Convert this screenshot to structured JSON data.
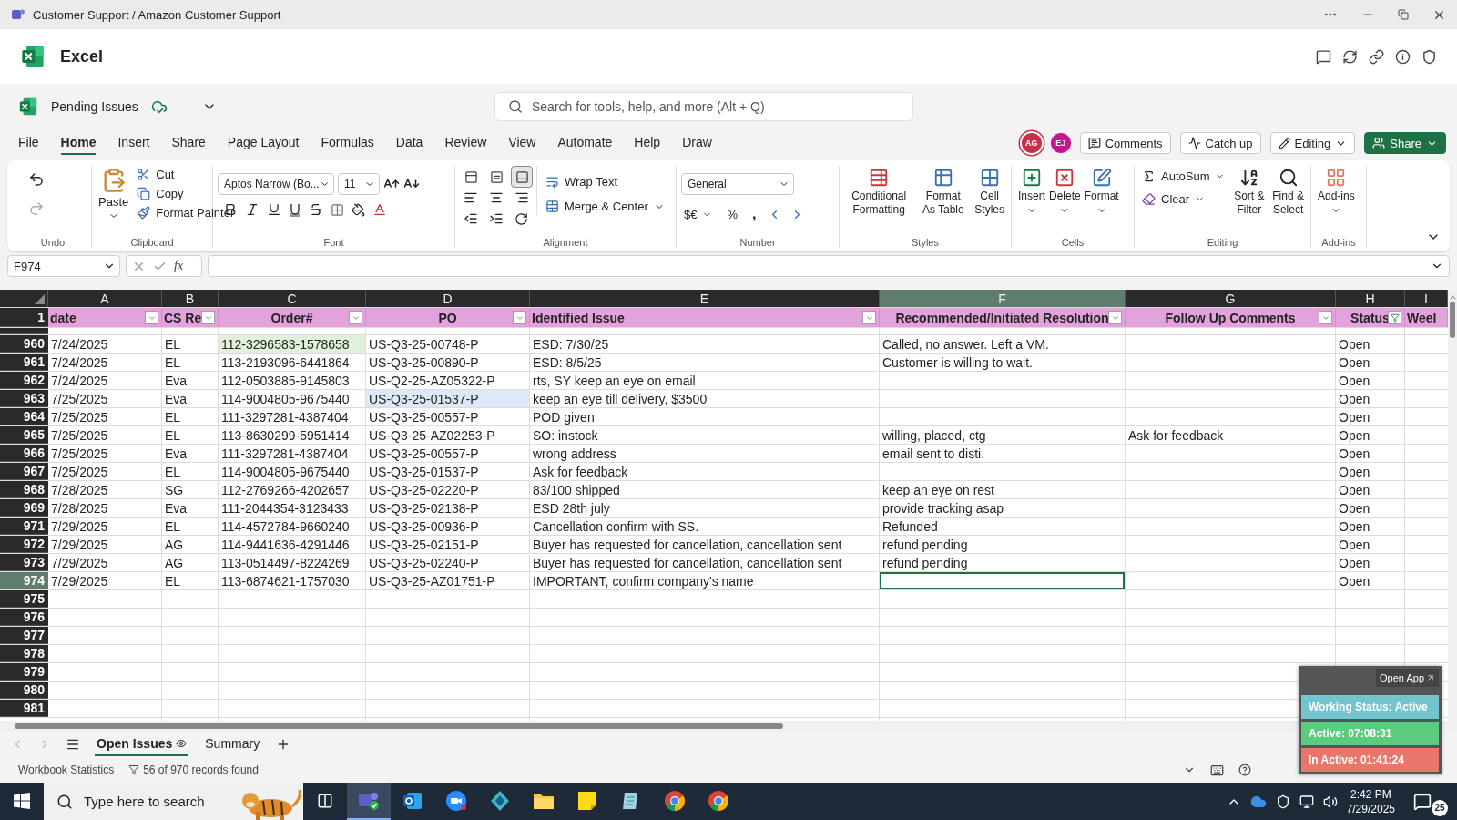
{
  "window": {
    "title": "Customer Support / Amazon Customer Support"
  },
  "app": {
    "name": "Excel"
  },
  "file": {
    "name": "Pending Issues"
  },
  "search": {
    "placeholder": "Search for tools, help, and more (Alt + Q)"
  },
  "menu": [
    {
      "label": "File",
      "selected": false
    },
    {
      "label": "Home",
      "selected": true
    },
    {
      "label": "Insert",
      "selected": false
    },
    {
      "label": "Share",
      "selected": false
    },
    {
      "label": "Page Layout",
      "selected": false
    },
    {
      "label": "Formulas",
      "selected": false
    },
    {
      "label": "Data",
      "selected": false
    },
    {
      "label": "Review",
      "selected": false
    },
    {
      "label": "View",
      "selected": false
    },
    {
      "label": "Automate",
      "selected": false
    },
    {
      "label": "Help",
      "selected": false
    },
    {
      "label": "Draw",
      "selected": false
    }
  ],
  "collaborators": [
    {
      "initials": "AG",
      "color": "#c4314b"
    },
    {
      "initials": "EJ",
      "color": "#c2188f"
    }
  ],
  "actions": {
    "comments": "Comments",
    "catch_up": "Catch up",
    "mode": "Editing",
    "share": "Share"
  },
  "ribbon": {
    "undo": {
      "label": "Undo"
    },
    "clipboard": {
      "label": "Clipboard",
      "paste": "Paste",
      "items": [
        "Cut",
        "Copy",
        "Format Painter"
      ]
    },
    "font": {
      "label": "Font",
      "family": "Aptos Narrow (Bo...",
      "size": "11"
    },
    "alignment": {
      "label": "Alignment",
      "vertical": [
        {
          "selected": false
        },
        {
          "selected": false
        },
        {
          "selected": true
        }
      ],
      "wrap": "Wrap Text",
      "merge": "Merge & Center"
    },
    "number": {
      "label": "Number",
      "format": "General",
      "currency": "$€",
      "percent": "%",
      "comma": ","
    },
    "styles": {
      "label": "Styles",
      "items": [
        "Conditional Formatting",
        "Format As Table",
        "Cell Styles"
      ]
    },
    "cells": {
      "label": "Cells",
      "items": [
        "Insert",
        "Delete",
        "Format"
      ]
    },
    "editing": {
      "label": "Editing",
      "autosum": "AutoSum",
      "clear": "Clear",
      "items": [
        "Sort & Filter",
        "Find & Select"
      ]
    },
    "addins": {
      "label": "Add-ins",
      "button": "Add-ins"
    }
  },
  "formula_bar": {
    "name_box": "F974",
    "function_label": "fx"
  },
  "columns": [
    {
      "letter": "A",
      "selected": false
    },
    {
      "letter": "B",
      "selected": false
    },
    {
      "letter": "C",
      "selected": false
    },
    {
      "letter": "D",
      "selected": false
    },
    {
      "letter": "E",
      "selected": false
    },
    {
      "letter": "F",
      "selected": true
    },
    {
      "letter": "G",
      "selected": false
    },
    {
      "letter": "H",
      "selected": false
    },
    {
      "letter": "I",
      "selected": false
    }
  ],
  "header_row": {
    "num": "1",
    "cells": [
      {
        "text": "date",
        "filtered": false
      },
      {
        "text": "CS Re",
        "filtered": false
      },
      {
        "text": "Order#",
        "filtered": false
      },
      {
        "text": "PO",
        "filtered": false
      },
      {
        "text": "Identified Issue",
        "filtered": false
      },
      {
        "text": "Recommended/Initiated Resolution",
        "filtered": false
      },
      {
        "text": "Follow Up Comments",
        "filtered": false
      },
      {
        "text": "Status",
        "filtered": true
      },
      {
        "text": "Weel"
      }
    ]
  },
  "rows": [
    {
      "num": "960",
      "selected": false,
      "date": "7/24/2025",
      "rep": "EL",
      "order": "112-3296583-1578658",
      "po": "US-Q3-25-00748-P",
      "issue": "ESD: 7/30/25",
      "resolution": "Called, no answer. Left a VM.",
      "status": "Open",
      "highlight": {
        "order": {
          "color": "#e2efda"
        }
      }
    },
    {
      "num": "961",
      "selected": false,
      "date": "7/24/2025",
      "rep": "EL",
      "order": "113-2193096-6441864",
      "po": "US-Q3-25-00890-P",
      "issue": "ESD: 8/5/25",
      "resolution": "Customer is willing to wait.",
      "status": "Open"
    },
    {
      "num": "962",
      "selected": false,
      "date": "7/24/2025",
      "rep": "Eva",
      "order": "112-0503885-9145803",
      "po": "US-Q2-25-AZ05322-P",
      "issue": "rts, SY keep an eye on email",
      "status": "Open"
    },
    {
      "num": "963",
      "selected": false,
      "date": "7/25/2025",
      "rep": "Eva",
      "order": "114-9004805-9675440",
      "po": "US-Q3-25-01537-P",
      "issue": "keep an eye till delivery, $3500",
      "status": "Open",
      "highlight": {
        "po": {
          "color": "#dde9f6"
        }
      }
    },
    {
      "num": "964",
      "selected": false,
      "date": "7/25/2025",
      "rep": "EL",
      "order": "111-3297281-4387404",
      "po": "US-Q3-25-00557-P",
      "issue": "POD given",
      "status": "Open"
    },
    {
      "num": "965",
      "selected": false,
      "date": "7/25/2025",
      "rep": "EL",
      "order": "113-8630299-5951414",
      "po": "US-Q3-25-AZ02253-P",
      "issue": "SO: instock",
      "resolution": "willing, placed, ctg",
      "followup": "Ask for feedback",
      "status": "Open"
    },
    {
      "num": "966",
      "selected": false,
      "date": "7/25/2025",
      "rep": "Eva",
      "order": "111-3297281-4387404",
      "po": "US-Q3-25-00557-P",
      "issue": "wrong address",
      "resolution": "email sent to disti.",
      "status": "Open"
    },
    {
      "num": "967",
      "selected": false,
      "date": "7/25/2025",
      "rep": "EL",
      "order": "114-9004805-9675440",
      "po": "US-Q3-25-01537-P",
      "issue": "Ask for feedback",
      "status": "Open"
    },
    {
      "num": "968",
      "selected": false,
      "date": "7/28/2025",
      "rep": "SG",
      "order": "112-2769266-4202657",
      "po": "US-Q3-25-02220-P",
      "issue": "83/100 shipped",
      "resolution": "keep an eye on rest",
      "status": "Open"
    },
    {
      "num": "969",
      "selected": false,
      "date": "7/28/2025",
      "rep": "Eva",
      "order": "111-2044354-3123433",
      "po": "US-Q3-25-02138-P",
      "issue": "ESD 28th july",
      "resolution": "provide tracking asap",
      "status": "Open"
    },
    {
      "num": "971",
      "selected": false,
      "date": "7/29/2025",
      "rep": "EL",
      "order": "114-4572784-9660240",
      "po": "US-Q3-25-00936-P",
      "issue": "Cancellation confirm with SS.",
      "resolution": "Refunded",
      "status": "Open"
    },
    {
      "num": "972",
      "selected": false,
      "date": "7/29/2025",
      "rep": "AG",
      "order": "114-9441636-4291446",
      "po": "US-Q3-25-02151-P",
      "issue": "Buyer has requested for cancellation, cancellation sent",
      "resolution": "refund pending",
      "status": "Open"
    },
    {
      "num": "973",
      "selected": false,
      "date": "7/29/2025",
      "rep": "AG",
      "order": "113-0514497-8224269",
      "po": "US-Q3-25-02240-P",
      "issue": "Buyer has requested for cancellation, cancellation sent",
      "resolution": "refund pending",
      "status": "Open"
    },
    {
      "num": "974",
      "selected": true,
      "date": "7/29/2025",
      "rep": "EL",
      "order": "113-6874621-1757030",
      "po": "US-Q3-25-AZ01751-P",
      "issue": "IMPORTANT, confirm company's name",
      "status": "Open"
    },
    {
      "num": "975",
      "selected": false
    },
    {
      "num": "976",
      "selected": false
    },
    {
      "num": "977",
      "selected": false
    },
    {
      "num": "978",
      "selected": false
    },
    {
      "num": "979",
      "selected": false
    },
    {
      "num": "980",
      "selected": false
    },
    {
      "num": "981",
      "selected": false
    }
  ],
  "sheets": [
    {
      "label": "Open Issues",
      "selected": true
    },
    {
      "label": "Summary",
      "selected": false
    }
  ],
  "status_bar": {
    "statistics": "Workbook Statistics",
    "records": "56 of 970 records found"
  },
  "widget": {
    "open_app": "Open App",
    "items": [
      {
        "text": "Working Status: Active",
        "color": "#74c4cf"
      },
      {
        "text": "Active: 07:08:31",
        "color": "#5ccb7f"
      },
      {
        "text": "In Active: 01:41:24",
        "color": "#e8766c"
      }
    ]
  },
  "taskbar": {
    "search_placeholder": "Type here to search",
    "time": "2:42 PM",
    "date": "7/29/2025",
    "notifications": "25"
  }
}
